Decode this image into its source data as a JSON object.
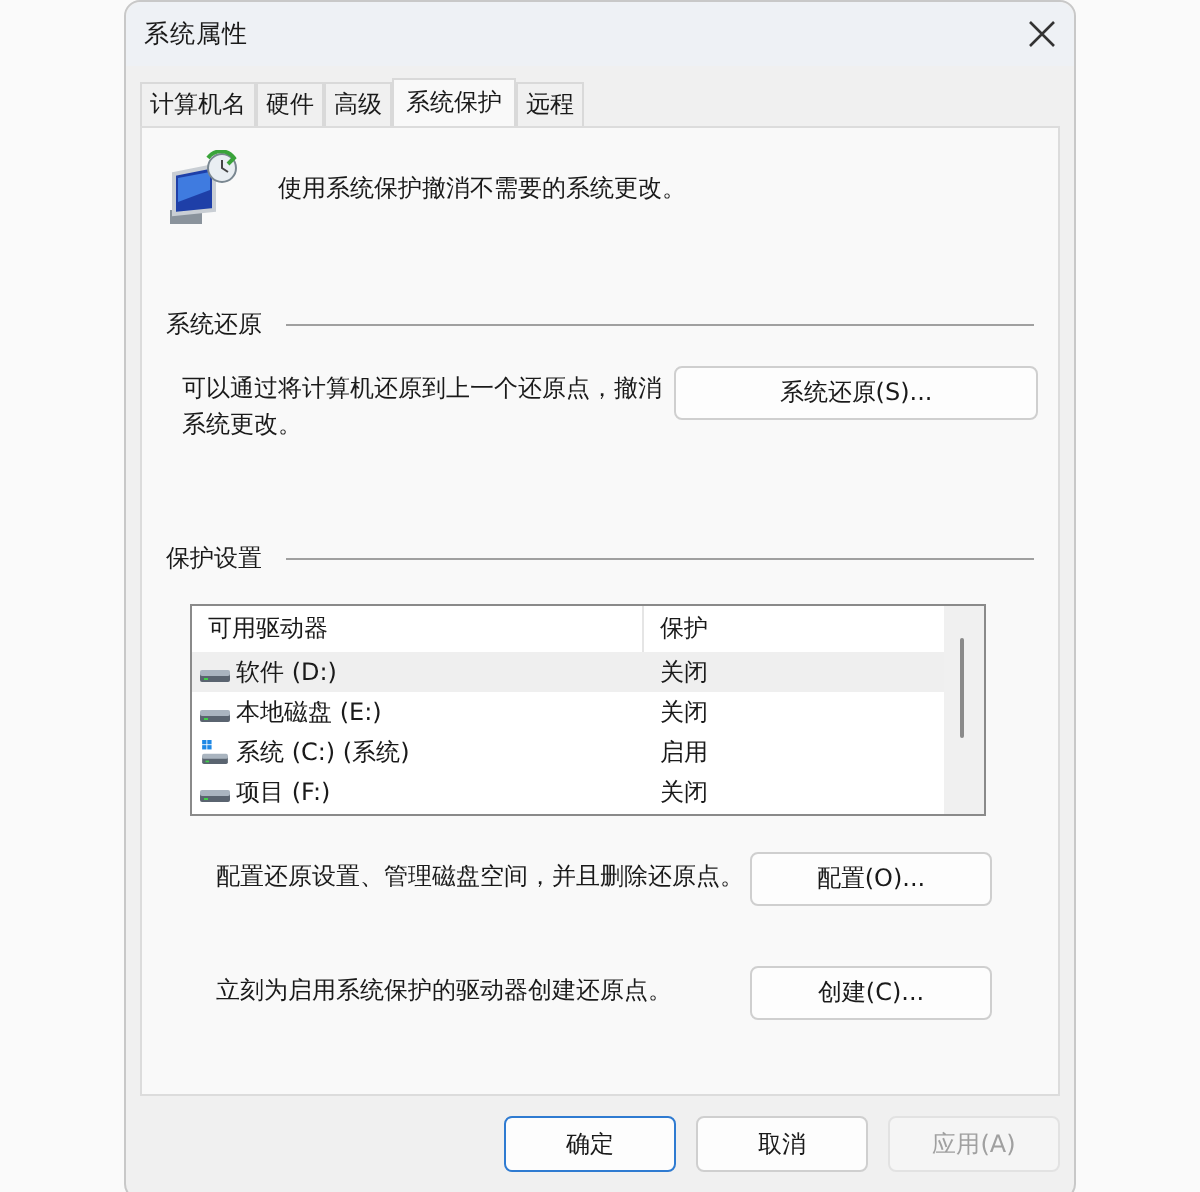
{
  "window": {
    "title": "系统属性"
  },
  "tabs": [
    {
      "label": "计算机名",
      "selected": false
    },
    {
      "label": "硬件",
      "selected": false
    },
    {
      "label": "高级",
      "selected": false
    },
    {
      "label": "系统保护",
      "selected": true
    },
    {
      "label": "远程",
      "selected": false
    }
  ],
  "intro": "使用系统保护撤消不需要的系统更改。",
  "restore_section": {
    "title": "系统还原",
    "description": "可以通过将计算机还原到上一个还原点，撤消系统更改。",
    "button": "系统还原(S)..."
  },
  "protection_section": {
    "title": "保护设置",
    "columns": [
      "可用驱动器",
      "保护"
    ],
    "drives": [
      {
        "kind": "drive",
        "name": "软件 (D:)",
        "protection": "关闭",
        "selected": true
      },
      {
        "kind": "drive",
        "name": "本地磁盘 (E:)",
        "protection": "关闭",
        "selected": false
      },
      {
        "kind": "system",
        "name": "系统 (C:) (系统)",
        "protection": "启用",
        "selected": false
      },
      {
        "kind": "drive",
        "name": "项目 (F:)",
        "protection": "关闭",
        "selected": false
      }
    ],
    "configure_text": "配置还原设置、管理磁盘空间，并且删除还原点。",
    "configure_button": "配置(O)...",
    "create_text": "立刻为启用系统保护的驱动器创建还原点。",
    "create_button": "创建(C)..."
  },
  "buttons": [
    {
      "label": "确定",
      "default": true,
      "disabled": false
    },
    {
      "label": "取消",
      "default": false,
      "disabled": false
    },
    {
      "label": "应用(A)",
      "default": false,
      "disabled": true
    }
  ]
}
